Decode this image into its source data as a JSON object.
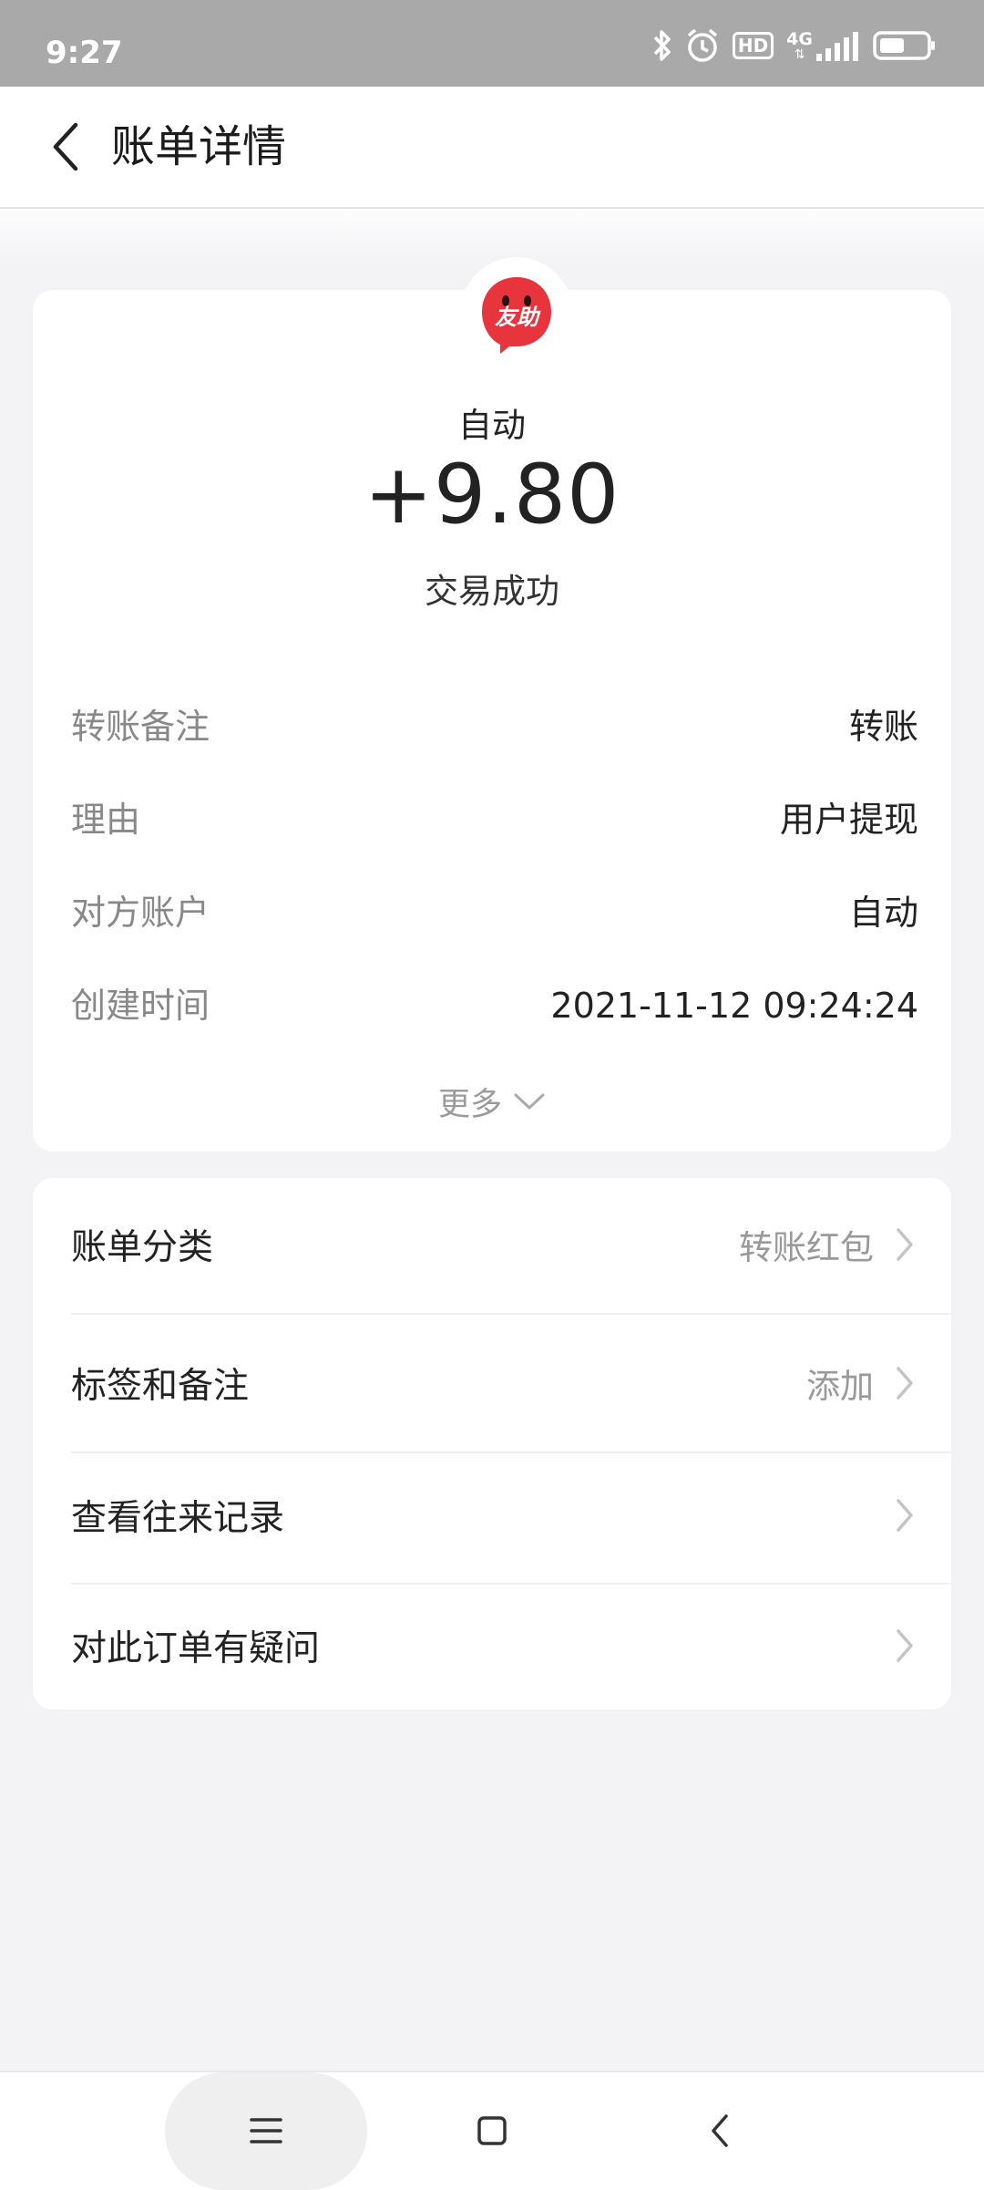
{
  "status_bar": {
    "time": "9:27",
    "icons": [
      "bluetooth-icon",
      "alarm-icon",
      "hd-icon",
      "signal-4g-icon",
      "battery-icon"
    ],
    "hd": "HD",
    "network": "4G"
  },
  "header": {
    "title": "账单详情",
    "back_icon": "chevron-left-icon"
  },
  "detail": {
    "avatar_text": "友助",
    "avatar_color": "#e8343d",
    "payer": "自动",
    "amount": "+9.80",
    "status": "交易成功",
    "rows": [
      {
        "label": "转账备注",
        "value": "转账"
      },
      {
        "label": "理由",
        "value": "用户提现"
      },
      {
        "label": "对方账户",
        "value": "自动"
      },
      {
        "label": "创建时间",
        "value": "2021-11-12 09:24:24"
      }
    ],
    "more_label": "更多"
  },
  "menu": {
    "items": [
      {
        "label": "账单分类",
        "value": "转账红包"
      },
      {
        "label": "标签和备注",
        "value": "添加"
      },
      {
        "label": "查看往来记录",
        "value": ""
      },
      {
        "label": "对此订单有疑问",
        "value": ""
      }
    ]
  },
  "nav_bar": {
    "icons": [
      "menu-icon",
      "home-icon",
      "back-icon"
    ]
  }
}
